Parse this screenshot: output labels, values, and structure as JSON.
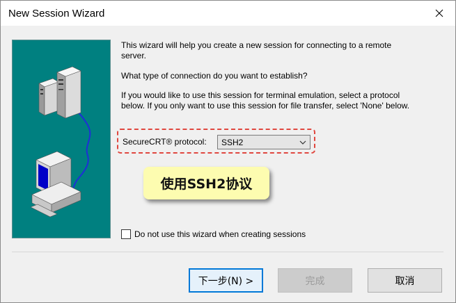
{
  "window": {
    "title": "New Session Wizard"
  },
  "icons": {
    "close": "close-icon",
    "servers": "server-tower-icon",
    "computer": "computer-icon"
  },
  "colors": {
    "illustration_bg": "#008080",
    "highlight_border": "#e0473f",
    "callout_bg": "#fdfcb0",
    "default_button_border": "#0078d7",
    "monitor_screen": "#0000c8"
  },
  "content": {
    "intro": "This wizard will help you create a new session for connecting to a remote server.",
    "question": "What type of connection do you want to establish?",
    "instructions": "If you would like to use this session for terminal emulation, select a protocol below.  If you only want to use this session for file transfer, select 'None' below."
  },
  "protocol": {
    "label": "SecureCRT® protocol:",
    "selected": "SSH2"
  },
  "callout": {
    "text": "使用SSH2协议"
  },
  "checkbox": {
    "label": "Do not use this wizard when creating sessions",
    "checked": false
  },
  "buttons": {
    "next": "下一步(N) >",
    "finish": "完成",
    "cancel": "取消"
  }
}
